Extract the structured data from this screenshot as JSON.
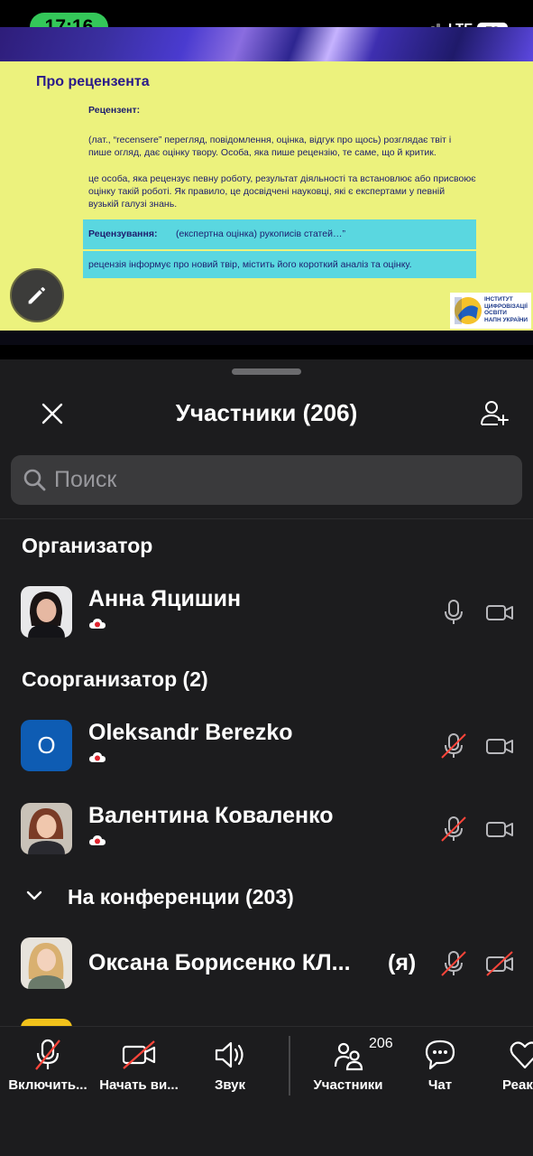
{
  "status_bar": {
    "time": "17:16",
    "network": "LTE",
    "battery": "73"
  },
  "slide": {
    "title": "Про рецензента",
    "label": "Рецензент:",
    "paragraph1": "(лат., “recensere” перегляд, повідомлення, оцінка, відгук про щось) розглядає твіт і пише огляд, дає оцінку твору. Особа, яка пише рецензію, те саме, що й критик.",
    "paragraph2": "це особа, яка рецензує певну роботу, результат діяльності та встановлює або присвоює оцінку такій роботі. Як правило, це досвідчені науковці, які є експертами у певній вузькій галузі знань.",
    "box1_label": "Рецензування:",
    "box1_text": "(експертна оцінка) рукописів статей…”",
    "box2_text": "рецензія інформує про новий твір, містить його короткий аналіз та оцінку.",
    "logo_lines": [
      "ІНСТИТУТ",
      "ЦИФРОВІЗАЦІЇ",
      "ОСВІТИ",
      "НАПН УКРАЇНИ"
    ]
  },
  "sheet": {
    "title": "Участники (206)",
    "search_placeholder": "Поиск",
    "sections": {
      "host": "Организатор",
      "cohosts": "Соорганизатор (2)",
      "in_meeting": "На конференции (203)"
    },
    "participants": [
      {
        "name": "Анна Яцишин",
        "mic": "on",
        "camera": "off"
      },
      {
        "name": "Oleksandr Berezko",
        "initial": "O",
        "mic": "muted",
        "camera": "off"
      },
      {
        "name": "Валентина Коваленко",
        "mic": "muted",
        "camera": "off"
      },
      {
        "name": "Оксана Борисенко КЛ...",
        "self_label": "(я)",
        "mic": "muted",
        "camera": "disabled"
      }
    ]
  },
  "toolbar": {
    "unmute": "Включить...",
    "start_video": "Начать ви...",
    "audio": "Звук",
    "participants": "Участники",
    "participants_count": "206",
    "chat": "Чат",
    "reactions": "Реак"
  },
  "colors": {
    "time_pill": "#34c759",
    "slide_bg": "#ecf27d",
    "slide_box": "#5ad7e0",
    "sheet_bg": "#1c1c1e",
    "muted_red": "#ff453a",
    "avatar_blue": "#0e5cb3"
  }
}
